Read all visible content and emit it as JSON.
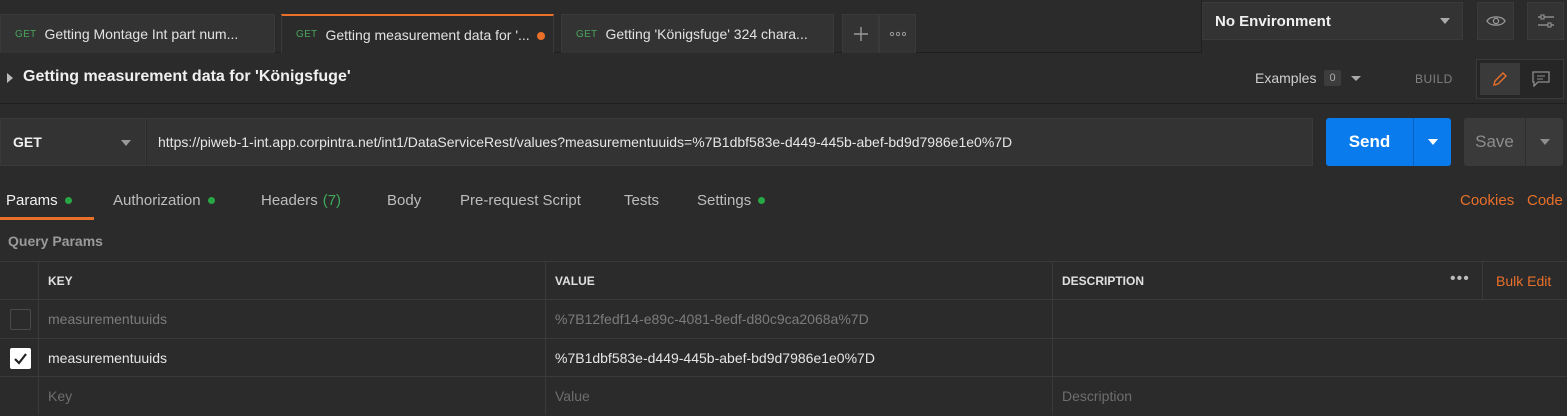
{
  "tabs": [
    {
      "method": "GET",
      "title": "Getting Montage Int part num...",
      "active": false
    },
    {
      "method": "GET",
      "title": "Getting measurement data for '...",
      "active": true
    },
    {
      "method": "GET",
      "title": "Getting 'Königsfuge' 324 chara...",
      "active": false
    }
  ],
  "environment": {
    "selected": "No Environment"
  },
  "request": {
    "title": "Getting measurement data for 'Königsfuge'",
    "examples_label": "Examples",
    "examples_count": "0",
    "build_label": "BUILD",
    "method": "GET",
    "url": "https://piweb-1-int.app.corpintra.net/int1/DataServiceRest/values?measurementuuids=%7B1dbf583e-d449-445b-abef-bd9d7986e1e0%7D",
    "send_label": "Send",
    "save_label": "Save"
  },
  "subtabs": {
    "params": "Params",
    "authorization": "Authorization",
    "headers": "Headers",
    "headers_count": "(7)",
    "body": "Body",
    "prerequest": "Pre-request Script",
    "tests": "Tests",
    "settings": "Settings",
    "cookies": "Cookies",
    "code": "Code"
  },
  "query_params": {
    "section_label": "Query Params",
    "columns": {
      "key": "KEY",
      "value": "VALUE",
      "description": "DESCRIPTION"
    },
    "bulk_edit": "Bulk Edit",
    "rows": [
      {
        "checked": false,
        "key": "measurementuuids",
        "value": "%7B12fedf14-e89c-4081-8edf-d80c9ca2068a%7D",
        "description": ""
      },
      {
        "checked": true,
        "key": "measurementuuids",
        "value": "%7B1dbf583e-d449-445b-abef-bd9d7986e1e0%7D",
        "description": ""
      }
    ],
    "placeholder": {
      "key": "Key",
      "value": "Value",
      "description": "Description"
    }
  }
}
